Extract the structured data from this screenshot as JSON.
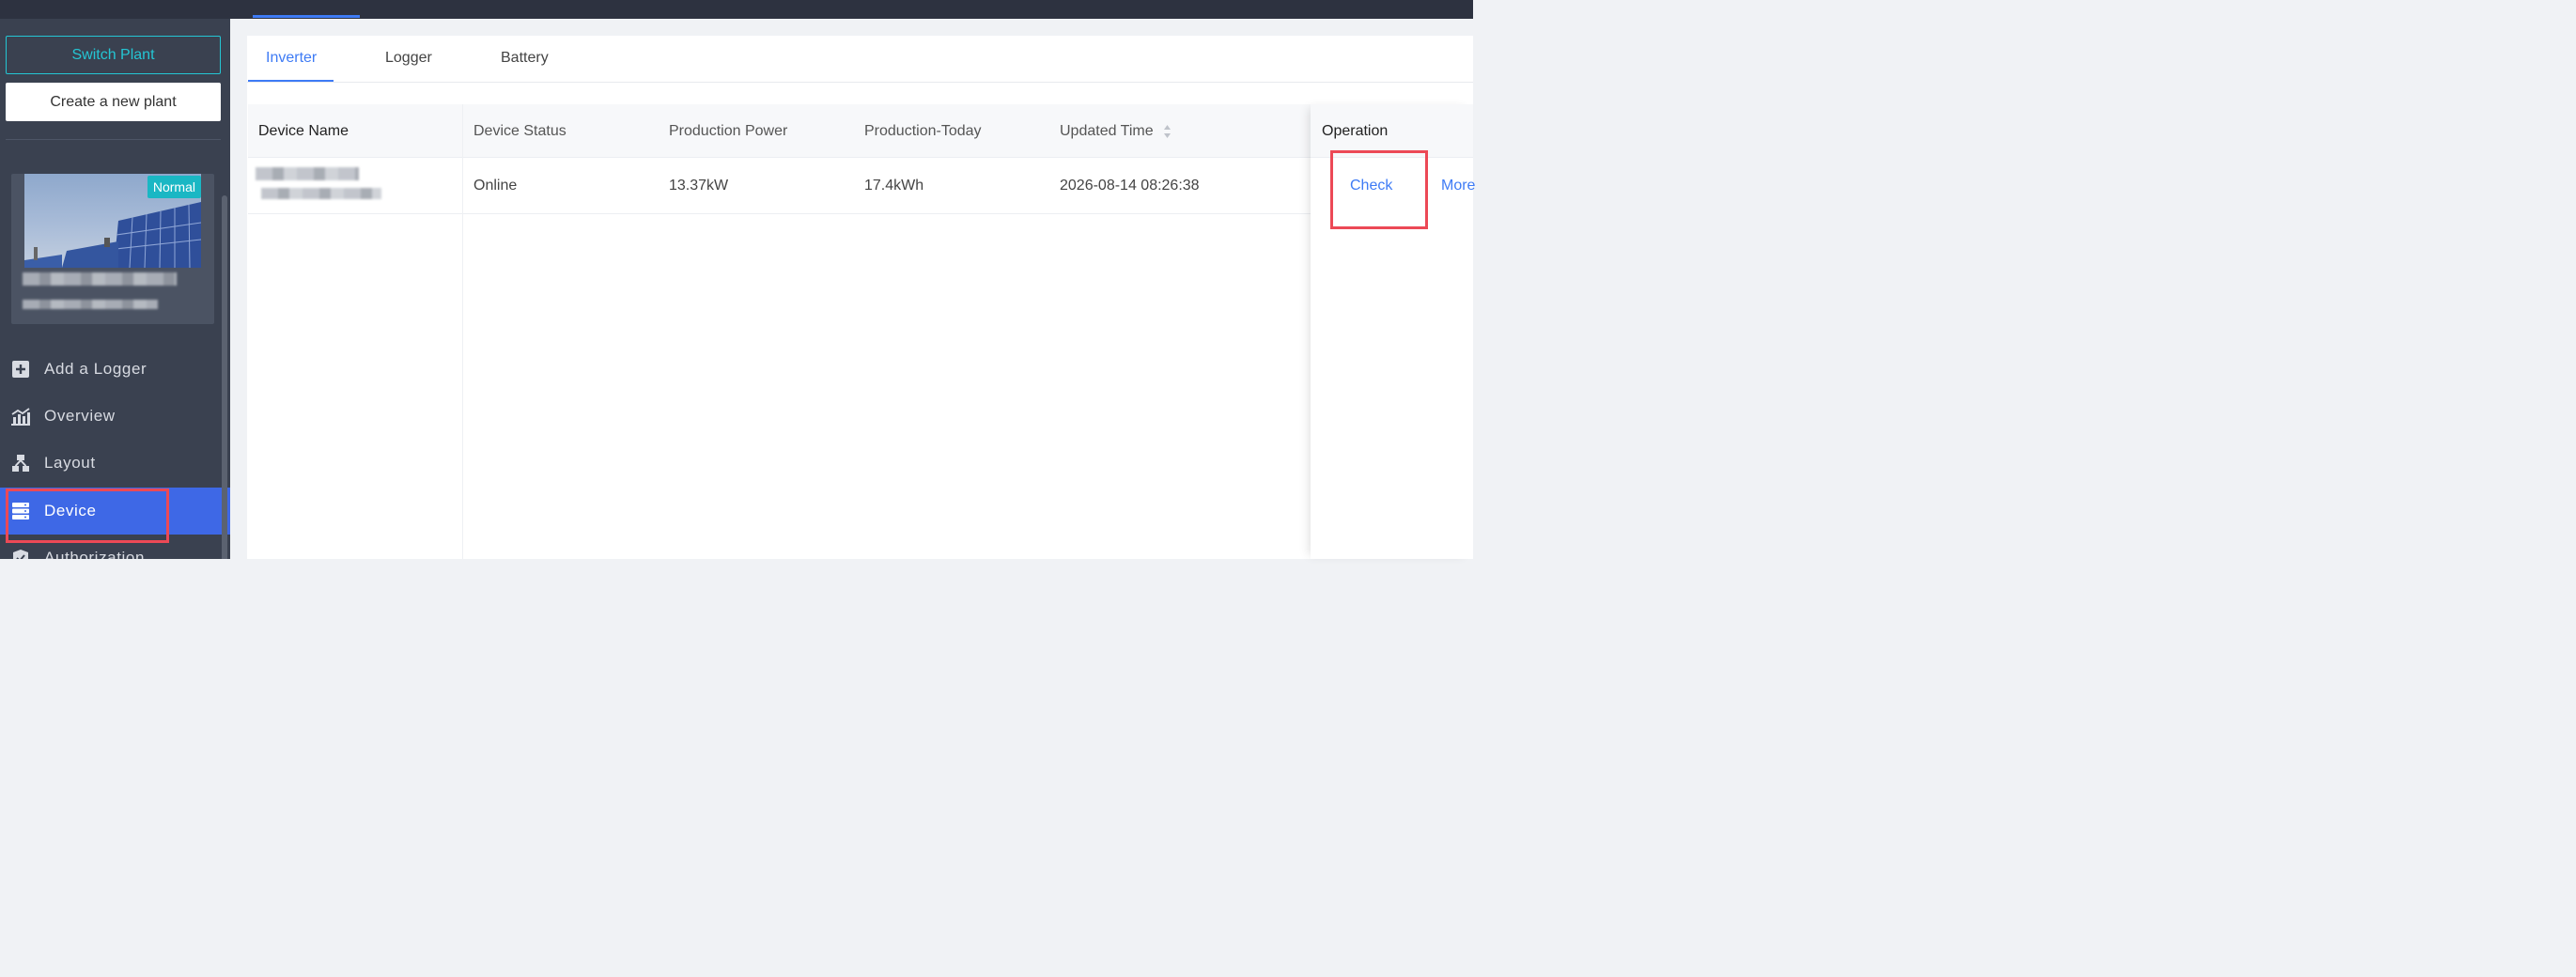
{
  "sidebar": {
    "switch_plant": "Switch Plant",
    "create_plant": "Create a new plant",
    "plant_card": {
      "badge": "Normal"
    },
    "nav": [
      {
        "label": "Add a Logger",
        "icon": "plus-square-icon"
      },
      {
        "label": "Overview",
        "icon": "chart-icon"
      },
      {
        "label": "Layout",
        "icon": "layout-icon"
      },
      {
        "label": "Device",
        "icon": "server-icon",
        "active": true
      },
      {
        "label": "Authorization",
        "icon": "shield-icon"
      }
    ]
  },
  "tabs": [
    "Inverter",
    "Logger",
    "Battery"
  ],
  "table": {
    "headers": [
      "Device Name",
      "Device Status",
      "Production Power",
      "Production-Today",
      "Updated Time",
      "Operation"
    ],
    "rows": [
      {
        "status": "Online",
        "power": "13.37kW",
        "today": "17.4kWh",
        "updated": "2026-08-14 08:26:38"
      }
    ],
    "actions": [
      "Check",
      "More"
    ]
  },
  "colors": {
    "accent": "#3e7bf5",
    "active_nav": "#3e68e6",
    "highlight_box": "#ec4956",
    "badge": "#1ab7c4"
  }
}
